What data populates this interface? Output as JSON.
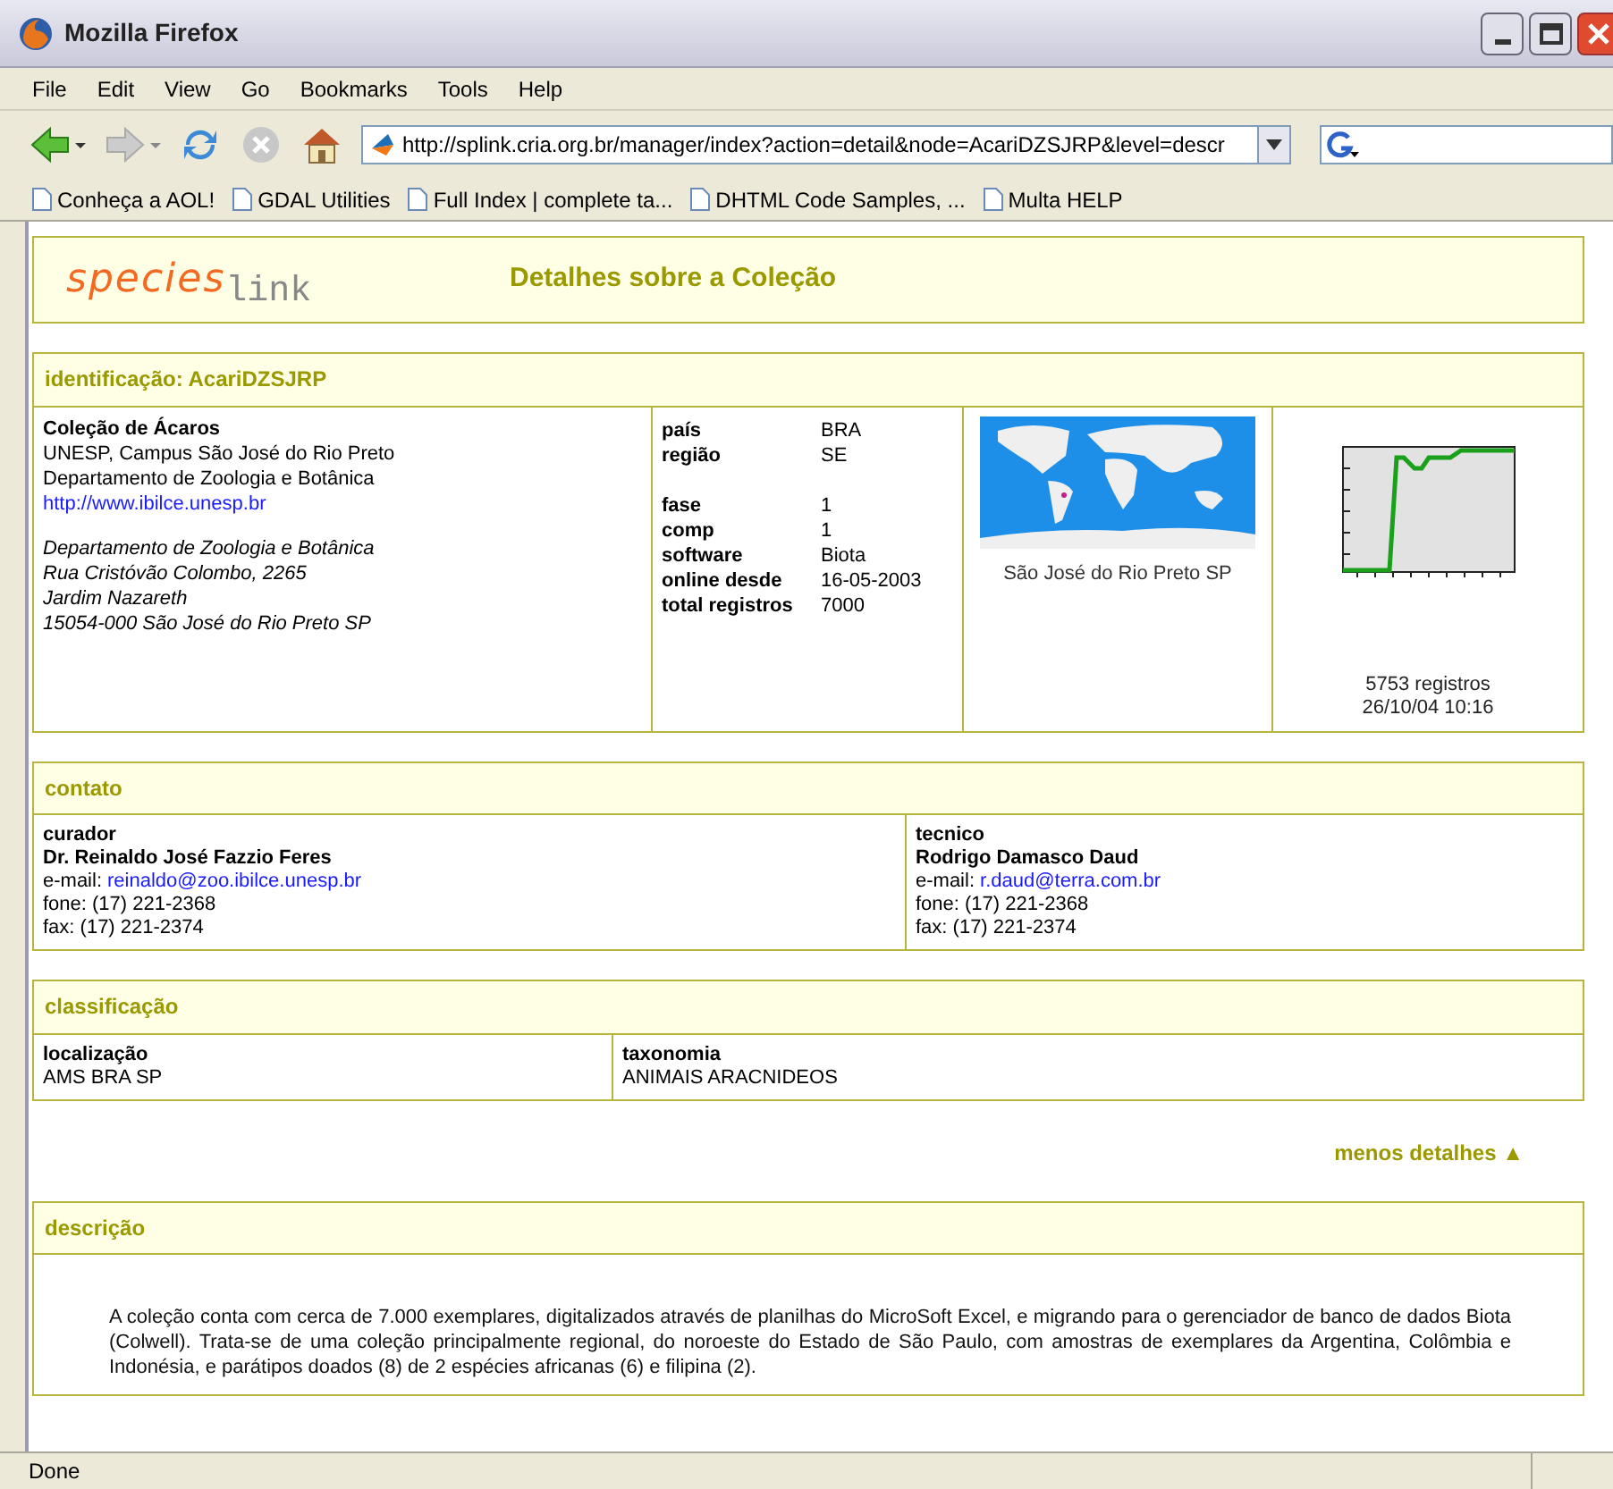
{
  "window": {
    "title": "Mozilla Firefox"
  },
  "menu": [
    "File",
    "Edit",
    "View",
    "Go",
    "Bookmarks",
    "Tools",
    "Help"
  ],
  "address": {
    "value": "http://splink.cria.org.br/manager/index?action=detail&node=AcariDZSJRP&level=descr"
  },
  "bookmarks": [
    "Conheça a AOL!",
    "GDAL Utilities",
    "Full Index | complete ta...",
    "DHTML Code Samples, ...",
    "Multa HELP"
  ],
  "page": {
    "logo": {
      "species": "species",
      "link": "link"
    },
    "heading": "Detalhes sobre a Coleção",
    "identification": {
      "title": "identificação: AcariDZSJRP",
      "name": "Coleção de Ácaros",
      "lines": [
        "UNESP, Campus São José do Rio Preto",
        "Departamento de Zoologia e Botânica"
      ],
      "url": "http://www.ibilce.unesp.br",
      "address": [
        "Departamento de Zoologia e Botânica",
        "Rua Cristóvão Colombo, 2265",
        "Jardim Nazareth",
        "15054-000 São José do Rio Preto SP"
      ],
      "fact_groups": [
        [
          {
            "label": "país",
            "value": "BRA"
          },
          {
            "label": "região",
            "value": "SE"
          }
        ],
        [
          {
            "label": "fase",
            "value": "1"
          },
          {
            "label": "comp",
            "value": "1"
          },
          {
            "label": "software",
            "value": "Biota"
          },
          {
            "label": "online desde",
            "value": "16-05-2003"
          },
          {
            "label": "total registros",
            "value": "7000"
          }
        ]
      ],
      "map_caption": "São José do Rio Preto SP",
      "chart_caption": [
        "5753 registros",
        "26/10/04 10:16"
      ]
    },
    "contact": {
      "title": "contato",
      "people": [
        {
          "role": "curador",
          "name": "Dr. Reinaldo José Fazzio Feres",
          "email_label": "e-mail:",
          "email": "reinaldo@zoo.ibilce.unesp.br",
          "phone": "fone: (17) 221-2368",
          "fax": "fax: (17) 221-2374"
        },
        {
          "role": "tecnico",
          "name": "Rodrigo Damasco Daud",
          "email_label": "e-mail:",
          "email": "r.daud@terra.com.br",
          "phone": "fone: (17) 221-2368",
          "fax": "fax: (17) 221-2374"
        }
      ]
    },
    "classification": {
      "title": "classificação",
      "columns": [
        {
          "label": "localização",
          "value": "AMS BRA SP"
        },
        {
          "label": "taxonomia",
          "value": "ANIMAIS ARACNIDEOS"
        }
      ]
    },
    "toggle": "menos detalhes ▲",
    "description": {
      "title": "descrição",
      "text": "A coleção conta com cerca de 7.000 exemplares, digitalizados através de planilhas do MicroSoft Excel, e migrando para o gerenciador de banco de dados Biota (Colwell). Trata-se de uma coleção principalmente regional, do noroeste do Estado de São Paulo, com amostras de exemplares da Argentina, Colômbia e Indonésia, e parátipos doados (8) de 2 espécies africanas (6) e filipina (2)."
    }
  },
  "status_bar": "Done"
}
